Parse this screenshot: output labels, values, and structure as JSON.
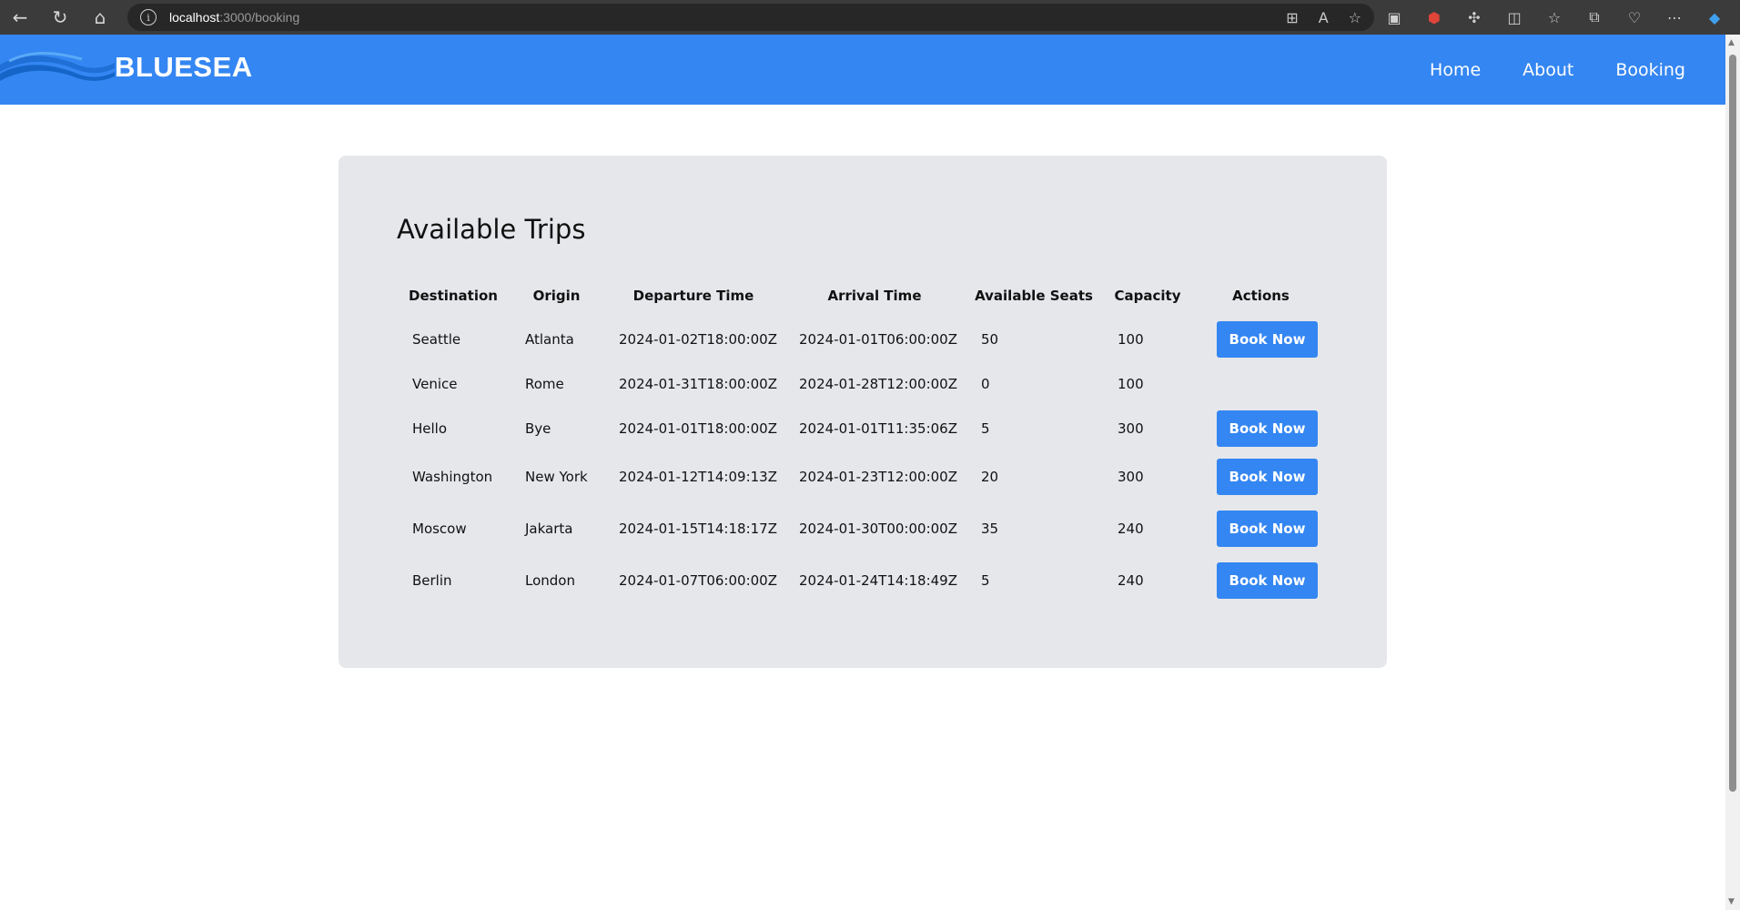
{
  "browser": {
    "url_host": "localhost",
    "url_path": ":3000/booking"
  },
  "site": {
    "brand": "BLUESEA",
    "nav": [
      {
        "label": "Home"
      },
      {
        "label": "About"
      },
      {
        "label": "Booking"
      }
    ]
  },
  "trips": {
    "title": "Available Trips",
    "columns": [
      "Destination",
      "Origin",
      "Departure Time",
      "Arrival Time",
      "Available Seats",
      "Capacity",
      "Actions"
    ],
    "rows": [
      {
        "destination": "Seattle",
        "origin": "Atlanta",
        "departure": "2024-01-02T18:00:00Z",
        "arrival": "2024-01-01T06:00:00Z",
        "seats": "50",
        "capacity": "100",
        "action": "Book Now"
      },
      {
        "destination": "Venice",
        "origin": "Rome",
        "departure": "2024-01-31T18:00:00Z",
        "arrival": "2024-01-28T12:00:00Z",
        "seats": "0",
        "capacity": "100",
        "action": ""
      },
      {
        "destination": "Hello",
        "origin": "Bye",
        "departure": "2024-01-01T18:00:00Z",
        "arrival": "2024-01-01T11:35:06Z",
        "seats": "5",
        "capacity": "300",
        "action": "Book Now"
      },
      {
        "destination": "Washington",
        "origin": "New York",
        "departure": "2024-01-12T14:09:13Z",
        "arrival": "2024-01-23T12:00:00Z",
        "seats": "20",
        "capacity": "300",
        "action": "Book Now"
      },
      {
        "destination": "Moscow",
        "origin": "Jakarta",
        "departure": "2024-01-15T14:18:17Z",
        "arrival": "2024-01-30T00:00:00Z",
        "seats": "35",
        "capacity": "240",
        "action": "Book Now"
      },
      {
        "destination": "Berlin",
        "origin": "London",
        "departure": "2024-01-07T06:00:00Z",
        "arrival": "2024-01-24T14:18:49Z",
        "seats": "5",
        "capacity": "240",
        "action": "Book Now"
      }
    ]
  },
  "colors": {
    "brand_blue": "#3486f2",
    "card_bg": "#e5e7eb"
  }
}
